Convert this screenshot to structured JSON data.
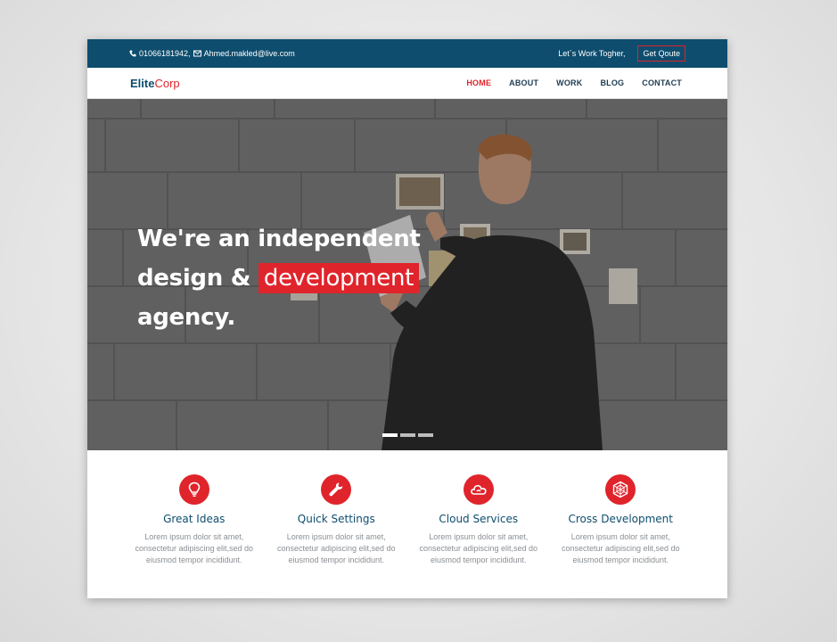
{
  "topbar": {
    "phone": "01066181942,",
    "email": "Ahmed.makled@live.com",
    "tagline": "Let`s Work Togher,",
    "quote_button": "Get Qoute"
  },
  "brand": {
    "part1": "Elite",
    "part2": "Corp"
  },
  "nav": [
    {
      "label": "HOME",
      "active": true
    },
    {
      "label": "ABOUT",
      "active": false
    },
    {
      "label": "WORK",
      "active": false
    },
    {
      "label": "BLOG",
      "active": false
    },
    {
      "label": "CONTACT",
      "active": false
    }
  ],
  "hero": {
    "line1": "We're an independent",
    "line2_prefix": "design &",
    "line2_highlight": "development",
    "line3": "agency.",
    "slide_count": 3,
    "active_slide": 1
  },
  "features": [
    {
      "icon": "lightbulb-icon",
      "title": "Great Ideas",
      "desc1": "Lorem ipsum dolor sit amet,",
      "desc2": "consectetur adipiscing elit,sed do",
      "desc3": "eiusmod tempor incididunt."
    },
    {
      "icon": "wrench-icon",
      "title": "Quick Settings",
      "desc1": "Lorem ipsum dolor sit amet,",
      "desc2": "consectetur adipiscing elit,sed do",
      "desc3": "eiusmod tempor incididunt."
    },
    {
      "icon": "cloud-icon",
      "title": "Cloud Services",
      "desc1": "Lorem ipsum dolor sit amet,",
      "desc2": "consectetur adipiscing elit,sed do",
      "desc3": "eiusmod tempor incididunt."
    },
    {
      "icon": "cube-icon",
      "title": "Cross Development",
      "desc1": "Lorem ipsum dolor sit amet,",
      "desc2": "consectetur adipiscing elit,sed do",
      "desc3": "eiusmod tempor incididunt."
    }
  ],
  "colors": {
    "primary": "#0e4d6e",
    "accent": "#e0242b",
    "text_muted": "#8a8f94"
  }
}
